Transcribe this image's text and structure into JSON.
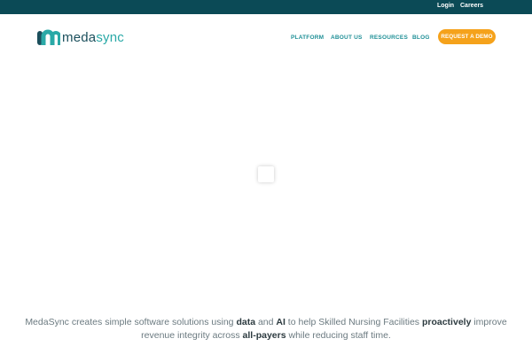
{
  "topbar": {
    "login": "Login",
    "careers": "Careers",
    "background": "#0b4a56"
  },
  "logo": {
    "icon": "medasync-m-icon",
    "name_part1": "meda",
    "name_part2": "sync"
  },
  "nav": {
    "items": [
      "PLATFORM",
      "ABOUT US",
      "RESOURCES",
      "BLOG"
    ],
    "cta": "REQUEST A DEMO",
    "cta_color": "#f5a21b",
    "link_color": "#1e8f96"
  },
  "tagline": {
    "t1": "MedaSync creates simple software solutions using ",
    "b1": "data",
    "t2": " and ",
    "b2": "AI",
    "t3": " to help Skilled Nursing Facilities ",
    "b3": "proactively",
    "t4": " improve revenue integrity across ",
    "b4": "all-payers",
    "t5": " while reducing staff time."
  }
}
